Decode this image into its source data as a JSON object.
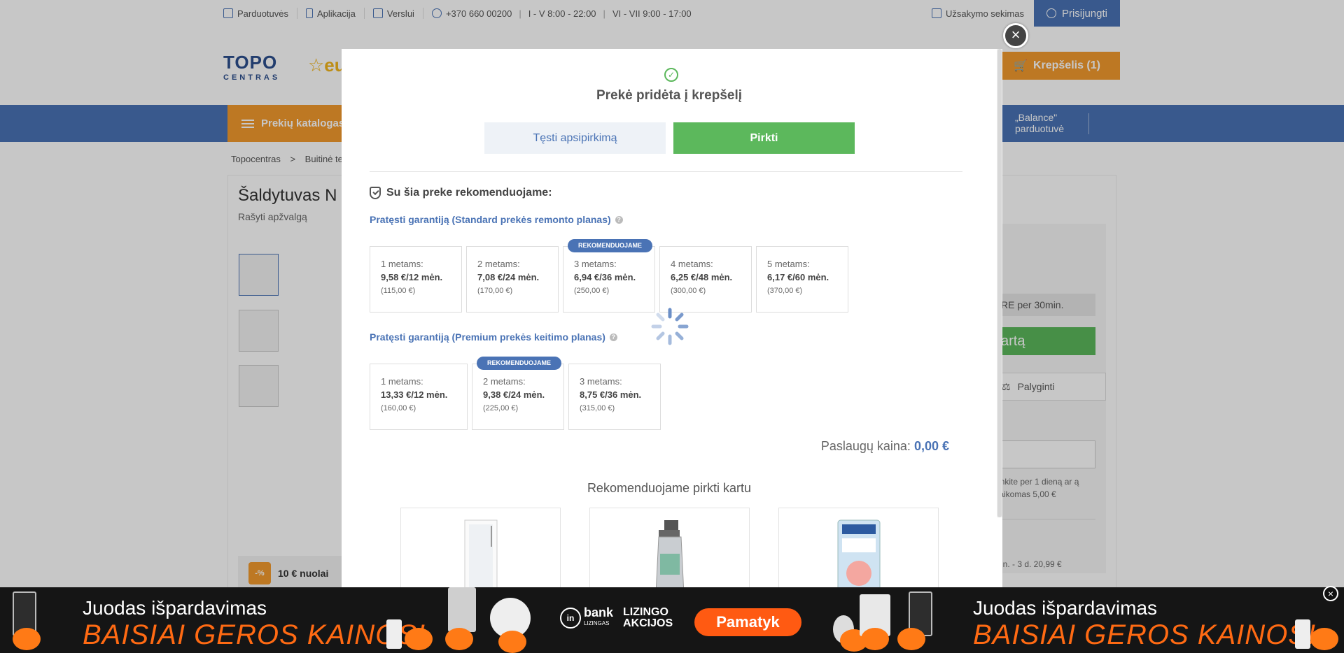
{
  "topbar": {
    "stores": "Parduotuvės",
    "app": "Aplikacija",
    "business": "Verslui",
    "phone": "+370 660 00200",
    "hours_weekday": "I - V 8:00 - 22:00",
    "hours_weekend": "VI - VII 9:00 - 17:00",
    "order_tracking": "Užsakymo sekimas",
    "login": "Prisijungti"
  },
  "header": {
    "logo_top": "TOPO",
    "logo_bottom": "CENTRAS",
    "logo_eu": "☆eu",
    "cart_label": "Krepšelis (1)"
  },
  "nav": {
    "catalog": "Prekių katalogas",
    "balance_line1": "„Balance\"",
    "balance_line2": "parduotuvė"
  },
  "breadcrumb": {
    "home": "Topocentras",
    "sep": ">",
    "category": "Buitinė te"
  },
  "product": {
    "title": "Šaldytuvas N",
    "review_link": "Rašyti apžvalgą",
    "promo_badge": "-%",
    "promo_text": "10 € nuolai",
    "reserve_text": "RE per 30min.",
    "cart_btn": "artą",
    "compare": "Palyginti",
    "pickup_text": "iimkite per 1 dieną ar ą (taikomas 5,00 €",
    "delivery_text": "min. - 3 d. 20,99 €"
  },
  "modal": {
    "title": "Prekė pridėta į krepšelį",
    "continue_btn": "Tęsti apsipirkimą",
    "buy_btn": "Pirkti",
    "recommend_heading": "Su šia preke rekomenduojame:",
    "standard_plan": {
      "title": "Pratęsti garantiją (Standard prekės remonto planas)",
      "badge": "REKOMENDUOJAME",
      "options": [
        {
          "years": "1 metams:",
          "monthly": "9,58 €/12 mėn.",
          "total": "(115,00 €)",
          "recommended": false
        },
        {
          "years": "2 metams:",
          "monthly": "7,08 €/24 mėn.",
          "total": "(170,00 €)",
          "recommended": false
        },
        {
          "years": "3 metams:",
          "monthly": "6,94 €/36 mėn.",
          "total": "(250,00 €)",
          "recommended": true
        },
        {
          "years": "4 metams:",
          "monthly": "6,25 €/48 mėn.",
          "total": "(300,00 €)",
          "recommended": false
        },
        {
          "years": "5 metams:",
          "monthly": "6,17 €/60 mėn.",
          "total": "(370,00 €)",
          "recommended": false
        }
      ]
    },
    "premium_plan": {
      "title": "Pratęsti garantiją (Premium prekės keitimo planas)",
      "badge": "REKOMENDUOJAME",
      "options": [
        {
          "years": "1 metams:",
          "monthly": "13,33 €/12 mėn.",
          "total": "(160,00 €)",
          "recommended": false
        },
        {
          "years": "2 metams:",
          "monthly": "9,38 €/24 mėn.",
          "total": "(225,00 €)",
          "recommended": true
        },
        {
          "years": "3 metams:",
          "monthly": "8,75 €/36 mėn.",
          "total": "(315,00 €)",
          "recommended": false
        }
      ]
    },
    "services_price_label": "Paslaugų kaina:",
    "services_price_value": "0,00 €",
    "buy_together_title": "Rekomenduojame pirkti kartu",
    "close_icon": "×"
  },
  "banner": {
    "line1": "Juodas išpardavimas",
    "line2": "BAISIAI GEROS KAINOS!",
    "bank_name": "bank",
    "bank_ring": "in",
    "bank_sub": "LIZINGAS",
    "lizingo1": "LIZINGO",
    "lizingo2": "AKCIJOS",
    "cta": "Pamatyk",
    "close_icon": "×"
  },
  "colors": {
    "brand_blue": "#4a73b5",
    "accent_orange": "#f29a2e",
    "buy_green": "#5cb85c",
    "banner_orange": "#ff6a13"
  }
}
